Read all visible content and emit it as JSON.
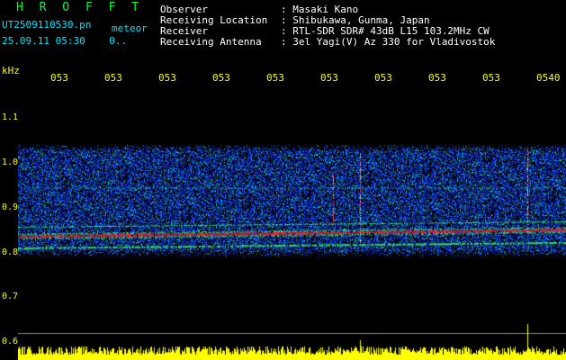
{
  "header": {
    "title": "H R O F F T",
    "file": "UT2509110530.pn",
    "meteor": "meteor",
    "datetime": "25.09.11 05:30    0.."
  },
  "meta": {
    "rows": [
      {
        "key": "Observer",
        "sep": ":",
        "value": "Masaki Kano"
      },
      {
        "key": "Receiving Location",
        "sep": ":",
        "value": "Shibukawa, Gunma, Japan"
      },
      {
        "key": "Receiver",
        "sep": ":",
        "value": "RTL-SDR SDR# 43dB L15 103.2MHz CW"
      },
      {
        "key": "Receiving Antenna",
        "sep": ":",
        "value": "3el Yagi(V) Az 330 for Vladivostok"
      }
    ]
  },
  "axis": {
    "unit": "kHz",
    "time_ticks": [
      "053",
      "053",
      "053",
      "053",
      "053",
      "053",
      "053",
      "053",
      "053",
      "0540"
    ],
    "freq_ticks": [
      "1.1",
      "1.0",
      "0.9",
      "0.8",
      "0.7",
      "0.6"
    ]
  },
  "colors": {
    "accent_green": "#00ff3a",
    "label_yellow": "#ffff00",
    "echo_red": "#ff2020",
    "noise_blue": "#1030d0"
  }
}
